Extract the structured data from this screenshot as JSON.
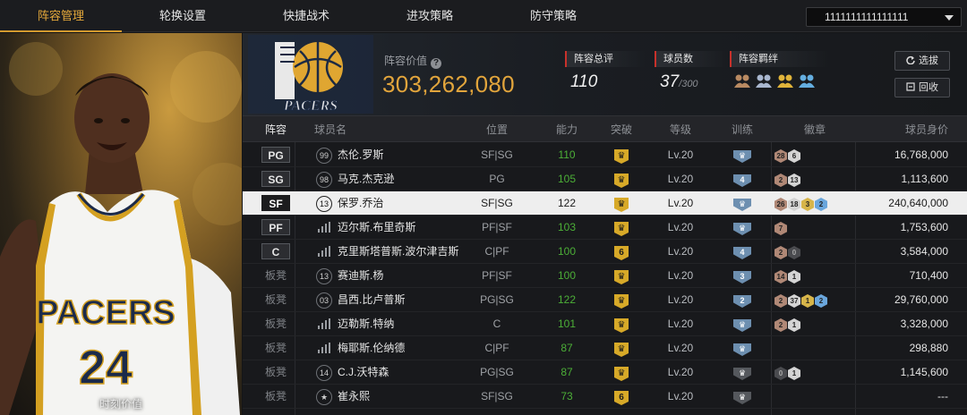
{
  "nav": {
    "tabs": [
      "阵容管理",
      "轮换设置",
      "快捷战术",
      "进攻策略",
      "防守策略"
    ],
    "active_index": 0,
    "lineup_select": "1111111111111111"
  },
  "portrait": {
    "caption": "时刻价值"
  },
  "team": {
    "logo_text": "PACERS"
  },
  "header": {
    "value_label": "阵容价值",
    "value_number": "303,262,080",
    "overall_label": "阵容总评",
    "overall_value": "110",
    "players_label": "球员数",
    "players_value": "37",
    "players_max": "/300",
    "bonds_label": "阵容羁绊",
    "select_button": "选拔",
    "recycle_button": "回收"
  },
  "table": {
    "headers": [
      "阵容",
      "球员名",
      "位置",
      "能力",
      "突破",
      "等级",
      "训练",
      "徽章",
      "球员身价"
    ],
    "rows": [
      {
        "slot": "PG",
        "num": "99",
        "name": "杰伦.罗斯",
        "pos": "SF|SG",
        "ability": "110",
        "break": "",
        "level": "Lv.20",
        "train": "",
        "badges": [
          [
            "bronze",
            "28"
          ],
          [
            "silver",
            "6"
          ]
        ],
        "salary": "16,768,000"
      },
      {
        "slot": "SG",
        "num": "98",
        "name": "马克.杰克逊",
        "pos": "PG",
        "ability": "105",
        "break": "",
        "level": "Lv.20",
        "train": "4",
        "badges": [
          [
            "bronze",
            "2"
          ],
          [
            "silver",
            "13"
          ]
        ],
        "salary": "1,113,600"
      },
      {
        "slot": "SF",
        "num": "13",
        "name": "保罗.乔治",
        "pos": "SF|SG",
        "ability": "122",
        "break": "",
        "level": "Lv.20",
        "train": "",
        "badges": [
          [
            "bronze",
            "26"
          ],
          [
            "silver",
            "18"
          ],
          [
            "gold",
            "3"
          ],
          [
            "blue",
            "2"
          ]
        ],
        "salary": "240,640,000"
      },
      {
        "slot": "PF",
        "num": "",
        "name": "迈尔斯.布里奇斯",
        "pos": "PF|SF",
        "ability": "103",
        "break": "",
        "level": "Lv.20",
        "train": "",
        "badges": [
          [
            "bronze",
            "7"
          ]
        ],
        "salary": "1,753,600"
      },
      {
        "slot": "C",
        "num": "",
        "name": "克里斯塔普斯.波尔津吉斯",
        "pos": "C|PF",
        "ability": "100",
        "break": "6",
        "level": "Lv.20",
        "train": "4",
        "badges": [
          [
            "bronze",
            "2"
          ],
          [
            "dark",
            "0"
          ]
        ],
        "salary": "3,584,000"
      },
      {
        "slot": "板凳",
        "num": "13",
        "name": "赛迪斯.杨",
        "pos": "PF|SF",
        "ability": "100",
        "break": "",
        "level": "Lv.20",
        "train": "3",
        "badges": [
          [
            "bronze",
            "14"
          ],
          [
            "silver",
            "1"
          ]
        ],
        "salary": "710,400"
      },
      {
        "slot": "板凳",
        "num": "03",
        "name": "昌西.比卢普斯",
        "pos": "PG|SG",
        "ability": "122",
        "break": "",
        "level": "Lv.20",
        "train": "2",
        "badges": [
          [
            "bronze",
            "2"
          ],
          [
            "silver",
            "37"
          ],
          [
            "gold",
            "1"
          ],
          [
            "blue",
            "2"
          ]
        ],
        "salary": "29,760,000"
      },
      {
        "slot": "板凳",
        "num": "",
        "name": "迈勒斯.特纳",
        "pos": "C",
        "ability": "101",
        "break": "",
        "level": "Lv.20",
        "train": "",
        "badges": [
          [
            "bronze",
            "2"
          ],
          [
            "silver",
            "1"
          ]
        ],
        "salary": "3,328,000"
      },
      {
        "slot": "板凳",
        "num": "",
        "name": "梅耶斯.伦纳德",
        "pos": "C|PF",
        "ability": "87",
        "break": "",
        "level": "Lv.20",
        "train": "",
        "badges": [],
        "salary": "298,880"
      },
      {
        "slot": "板凳",
        "num": "14",
        "name": "C.J.沃特森",
        "pos": "PG|SG",
        "ability": "87",
        "break": "",
        "level": "Lv.20",
        "train": "grey",
        "badges": [
          [
            "dark",
            "0"
          ],
          [
            "silver",
            "1"
          ]
        ],
        "salary": "1,145,600"
      },
      {
        "slot": "板凳",
        "num": "★",
        "name": "崔永熙",
        "pos": "SF|SG",
        "ability": "73",
        "break": "6",
        "level": "Lv.20",
        "train": "grey",
        "badges": [],
        "salary": "---"
      }
    ]
  },
  "colors": {
    "accent": "#e2a53c",
    "ability_green": "#4caf37",
    "label_red": "#c8312b"
  }
}
